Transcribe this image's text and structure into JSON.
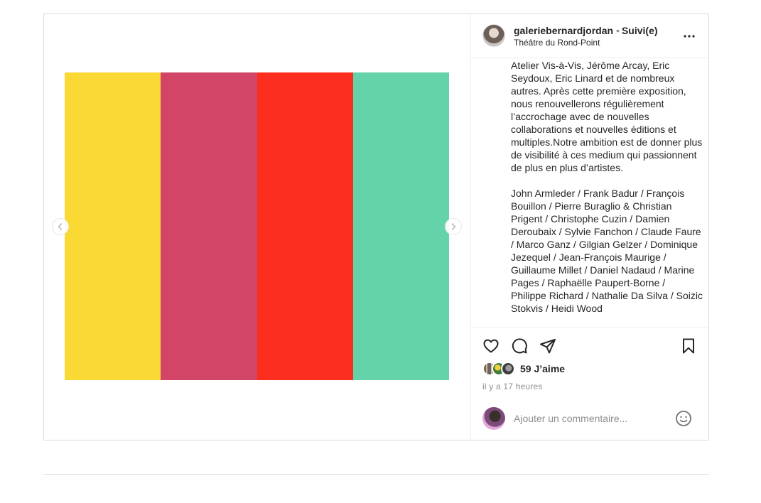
{
  "post": {
    "media": {
      "stripes": [
        "#fbd935",
        "#d34567",
        "#fb2e1f",
        "#64d3aa"
      ],
      "prev_icon": "chevron-left-icon",
      "next_icon": "chevron-right-icon"
    },
    "header": {
      "username": "galeriebernardjordan",
      "separator": "•",
      "follow_status": "Suivi(e)",
      "location": "Théâtre du Rond-Point",
      "more_icon": "more-horizontal-icon"
    },
    "caption": {
      "paragraph1": "Atelier Vis-à-Vis, Jérôme Arcay, Eric Seydoux, Eric Linard et de nombreux autres. Après cette première exposition, nous renouvellerons régulièrement l’accrochage avec de nouvelles collaborations et nouvelles éditions et multiples.Notre ambition est de donner plus de visibilité à ces medium qui passionnent de plus en plus d’artistes.",
      "paragraph2": "John Armleder / Frank Badur / François Bouillon / Pierre Buraglio & Christian Prigent / Christophe Cuzin / Damien Deroubaix / Sylvie Fanchon / Claude Faure / Marco Ganz / Gilgian Gelzer / Dominique Jezequel / Jean-François Maurige / Guillaume Millet / Daniel Nadaud / Marine Pages / Raphaëlle Paupert-Borne / Philippe Richard / Nathalie Da Silva / Soizic Stokvis / Heidi Wood"
    },
    "actions": {
      "like_icon": "heart-icon",
      "comment_icon": "comment-icon",
      "share_icon": "paper-plane-icon",
      "save_icon": "bookmark-icon",
      "likes_label": "59 J’aime",
      "timestamp": "il y a 17 heures"
    },
    "comment": {
      "placeholder": "Ajouter un commentaire...",
      "emoji_icon": "emoji-icon"
    }
  }
}
